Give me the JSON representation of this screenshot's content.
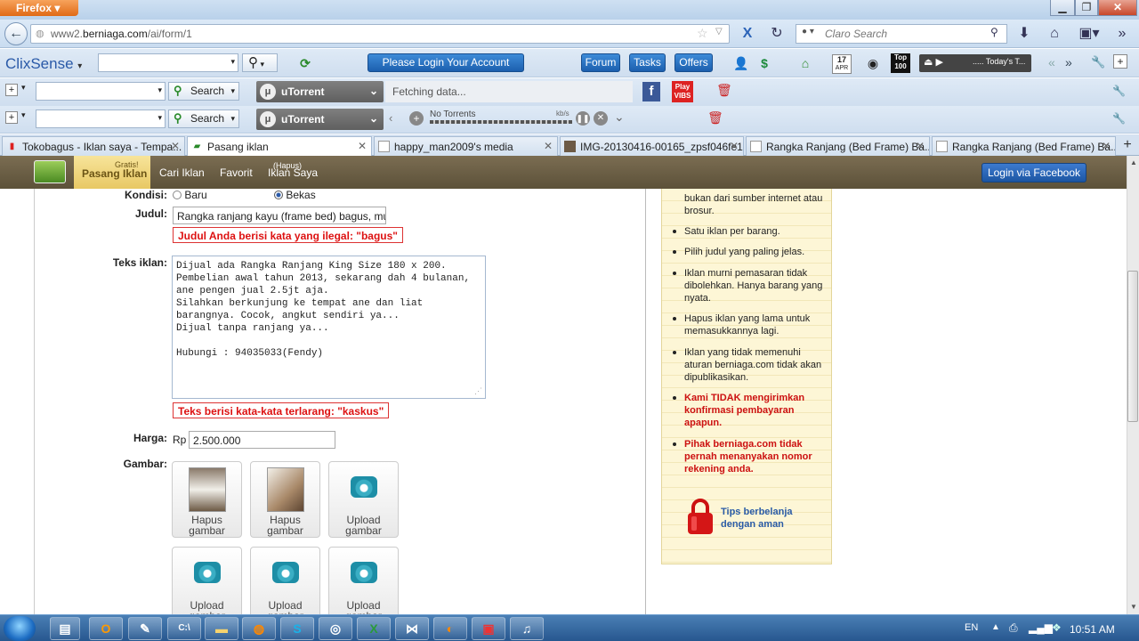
{
  "browser": {
    "app_button": "Firefox",
    "url_prefix": "www2.",
    "url_domain": "berniaga.com",
    "url_path": "/ai/form/1",
    "search_placeholder": "Claro Search",
    "window_controls": [
      "minimize-icon",
      "maximize-icon",
      "close-icon"
    ]
  },
  "toolbar1": {
    "logo": "ClixSense",
    "login_button": "Please Login Your Account",
    "forum": "Forum",
    "tasks": "Tasks",
    "offers": "Offers",
    "calendar_month": "APR",
    "calendar_day": "17",
    "top_badge": "Top 100",
    "player_text": "..... Today's T..."
  },
  "toolbar2": {
    "search_label": "Search",
    "utorrent": "uTorrent",
    "fetching": "Fetching data...",
    "play_badge": "Play VIBS"
  },
  "toolbar3": {
    "search_label": "Search",
    "utorrent": "uTorrent",
    "no_torrents": "No Torrents",
    "rate_unit": "kb/s"
  },
  "tabs": [
    {
      "label": "Tokobagus - Iklan saya - Tempa...",
      "active": false
    },
    {
      "label": "Pasang iklan",
      "active": true
    },
    {
      "label": "happy_man2009's media",
      "active": false
    },
    {
      "label": "IMG-20130416-00165_zpsf046fe1...",
      "active": false
    },
    {
      "label": "Rangka Ranjang (Bed Frame) Ba...",
      "active": false
    },
    {
      "label": "Rangka Ranjang (Bed Frame) Ba...",
      "active": false
    }
  ],
  "site_nav": {
    "gratis": "Gratis!",
    "pasang_iklan": "Pasang Iklan",
    "cari_iklan": "Cari Iklan",
    "favorit": "Favorit",
    "hapus": "(Hapus)",
    "iklan_saya": "Iklan Saya",
    "fb_login": "Login via Facebook"
  },
  "form": {
    "kondisi_label": "Kondisi:",
    "kondisi_baru": "Baru",
    "kondisi_bekas": "Bekas",
    "kondisi_selected": "Bekas",
    "judul_label": "Judul:",
    "judul_value": "Rangka ranjang kayu (frame bed) bagus, mur",
    "judul_error": "Judul Anda berisi kata yang ilegal: \"bagus\"",
    "teks_label": "Teks iklan:",
    "teks_value": "Dijual ada Rangka Ranjang King Size 180 x 200.\nPembelian awal tahun 2013, sekarang dah 4 bulanan,\nane pengen jual 2.5jt aja.\nSilahkan berkunjung ke tempat ane dan liat\nbarangnya. Cocok, angkut sendiri ya...\nDijual tanpa ranjang ya...\n\nHubungi : 94035033(Fendy)",
    "teks_error": "Teks berisi kata-kata terlarang: \"kaskus\"",
    "harga_label": "Harga:",
    "harga_currency": "Rp",
    "harga_value": "2.500.000",
    "gambar_label": "Gambar:",
    "images": [
      {
        "line1": "Hapus",
        "line2": "gambar",
        "type": "photo"
      },
      {
        "line1": "Hapus",
        "line2": "gambar",
        "type": "photo"
      },
      {
        "line1": "Upload",
        "line2": "gambar",
        "type": "camera"
      },
      {
        "line1": "Upload",
        "line2": "gambar",
        "type": "camera"
      },
      {
        "line1": "Upload",
        "line2": "gambar",
        "type": "camera"
      },
      {
        "line1": "Upload",
        "line2": "gambar",
        "type": "camera"
      }
    ]
  },
  "notes": {
    "items": [
      {
        "text": "bukan dari sumber internet atau brosur.",
        "red": false,
        "bullet": false
      },
      {
        "text": "Satu iklan per barang.",
        "red": false,
        "bullet": true
      },
      {
        "text": "Pilih judul yang paling jelas.",
        "red": false,
        "bullet": true
      },
      {
        "text": "Iklan murni pemasaran tidak dibolehkan. Hanya barang yang nyata.",
        "red": false,
        "bullet": true
      },
      {
        "text": "Hapus iklan yang lama untuk memasukkannya lagi.",
        "red": false,
        "bullet": true
      },
      {
        "text": "Iklan yang tidak memenuhi aturan berniaga.com tidak akan dipublikasikan.",
        "red": false,
        "bullet": true
      },
      {
        "text": "Kami TIDAK mengirimkan konfirmasi pembayaran apapun.",
        "red": true,
        "bullet": true
      },
      {
        "text": "Pihak berniaga.com tidak pernah menanyakan nomor rekening anda.",
        "red": true,
        "bullet": true
      }
    ],
    "tips": "Tips berbelanja dengan aman"
  },
  "taskbar": {
    "lang": "EN",
    "clock": "10:51 AM"
  }
}
